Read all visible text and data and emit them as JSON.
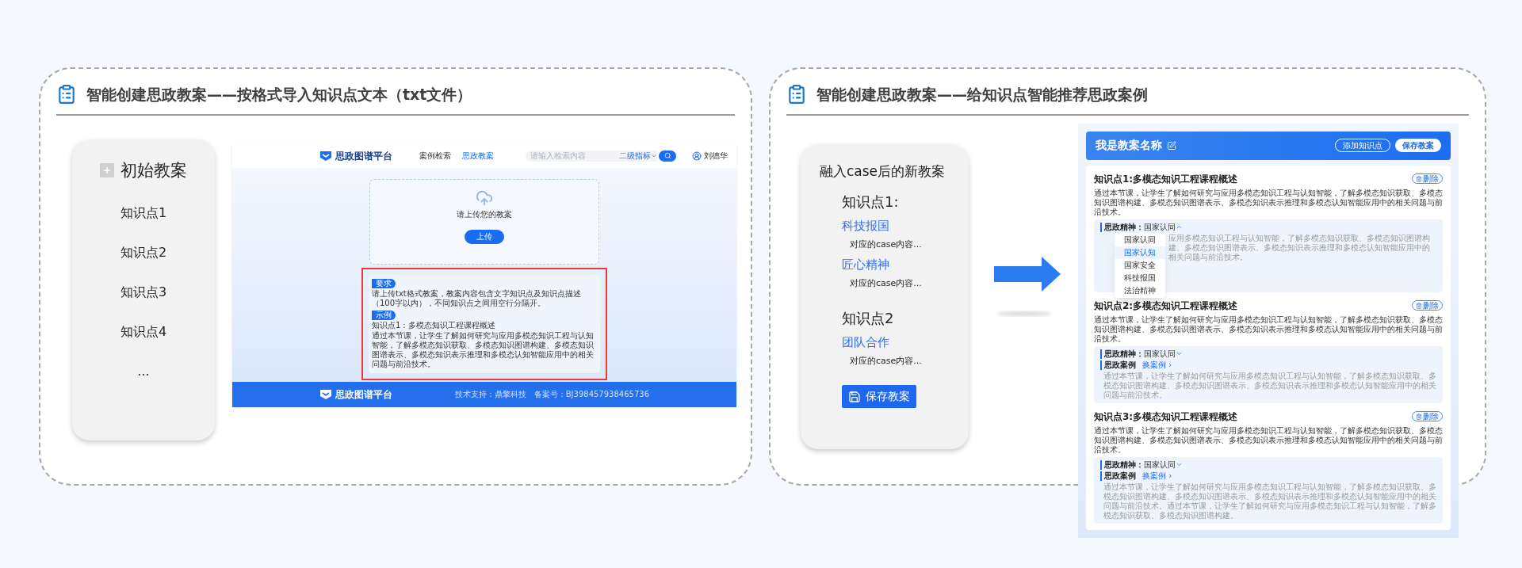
{
  "import_panel": {
    "title": "智能创建思政教案——按格式导入知识点文本（txt文件）",
    "lesson_card": {
      "heading": "初始教案",
      "items": [
        "知识点1",
        "知识点2",
        "知识点3",
        "知识点4",
        "..."
      ]
    },
    "screen": {
      "logo": "思政图谱平台",
      "nav": [
        {
          "label": "案例检索",
          "selected": false
        },
        {
          "label": "思政教案",
          "selected": true
        }
      ],
      "search": {
        "placeholder": "请输入检索内容",
        "filter": "二级指标"
      },
      "user": "刘德华",
      "upload": {
        "hint": "请上传您的教案",
        "button": "上传"
      },
      "requirements": {
        "highlighted": true,
        "blocks": [
          {
            "tag": "要求",
            "lines": [
              "请上传txt格式教案，教案内容包含文字知识点及知识点描述（100字以内），不同知识点之间用空行分隔开。"
            ]
          },
          {
            "tag": "示例",
            "lines": [
              "知识点1：多模态知识工程课程概述",
              "通过本节课，让学生了解如何研究与应用多模态知识工程与认知智能，了解多模态知识获取、多模态知识图谱构建、多模态知识图谱表示、多模态知识表示推理和多模态认知智能应用中的相关问题与前沿技术。"
            ]
          }
        ]
      },
      "footer": {
        "logo": "思政图谱平台",
        "support": "技术支持：鼎擎科技",
        "record": "备案号：BJ398457938465736"
      }
    }
  },
  "recommend_panel": {
    "title": "智能创建思政教案——给知识点智能推荐思政案例",
    "lesson_card": {
      "heading": "融入case后的新教案",
      "points": [
        {
          "title": "知识点1:",
          "cases": [
            {
              "name": "科技报国",
              "content": "对应的case内容..."
            },
            {
              "name": "匠心精神",
              "content": "对应的case内容..."
            }
          ]
        },
        {
          "title": "知识点2",
          "cases": [
            {
              "name": "团队合作",
              "content": "对应的case内容..."
            }
          ]
        }
      ],
      "save_button": "保存教案"
    },
    "screen": {
      "lesson_name": "我是教案名称",
      "buttons": [
        {
          "label": "添加知识点",
          "kind": "outline"
        },
        {
          "label": "保存教案",
          "kind": "solid"
        }
      ],
      "points": [
        {
          "title": "知识点1:多模态知识工程课程概述",
          "delete": "删除",
          "description": "通过本节课，让学生了解如何研究与应用多模态知识工程与认知智能，了解多模态知识获取、多模态知识图谱构建、多模态知识图谱表示、多模态知识表示推理和多模态认知智能应用中的相关问题与前沿技术。",
          "spirit_label": "思政精神：",
          "spirit": "国家认同",
          "expanded": true,
          "options": [
            {
              "label": "国家认同",
              "selected": false
            },
            {
              "label": "国家认知",
              "selected": true
            },
            {
              "label": "国家安全",
              "selected": false
            },
            {
              "label": "科技报国",
              "selected": false
            },
            {
              "label": "法治精神",
              "selected": false
            }
          ],
          "case_text": "应用多模态知识工程与认知智能，了解多模态知识获取、多模态知识图谱构建、多模态知识图谱表示、多模态知识表示推理和多模态认知智能应用中的相关问题与前沿技术。"
        },
        {
          "title": "知识点2:多模态知识工程课程概述",
          "delete": "删除",
          "description": "通过本节课，让学生了解如何研究与应用多模态知识工程与认知智能，了解多模态知识获取、多模态知识图谱构建、多模态知识图谱表示、多模态知识表示推理和多模态认知智能应用中的相关问题与前沿技术。",
          "spirit_label": "思政精神：",
          "spirit": "国家认同",
          "expanded": false,
          "case_label": "思政案例",
          "swap": "换案例 ›",
          "case_text": "通过本节课，让学生了解如何研究与应用多模态知识工程与认知智能，了解多模态知识获取、多模态知识图谱构建、多模态知识图谱表示、多模态知识表示推理和多模态认知智能应用中的相关问题与前沿技术。"
        },
        {
          "title": "知识点3:多模态知识工程课程概述",
          "delete": "删除",
          "description": "通过本节课，让学生了解如何研究与应用多模态知识工程与认知智能，了解多模态知识获取、多模态知识图谱构建、多模态知识图谱表示、多模态知识表示推理和多模态认知智能应用中的相关问题与前沿技术。",
          "spirit_label": "思政精神：",
          "spirit": "国家认同",
          "expanded": false,
          "case_label": "思政案例",
          "swap": "换案例 ›",
          "case_text": "通过本节课，让学生了解如何研究与应用多模态知识工程与认知智能，了解多模态知识获取、多模态知识图谱构建、多模态知识图谱表示、多模态知识表示推理和多模态认知智能应用中的相关问题与前沿技术。通过本节课，让学生了解如何研究与应用多模态知识工程与认知智能，了解多模态知识获取、多模态知识图谱构建。"
        }
      ]
    }
  }
}
